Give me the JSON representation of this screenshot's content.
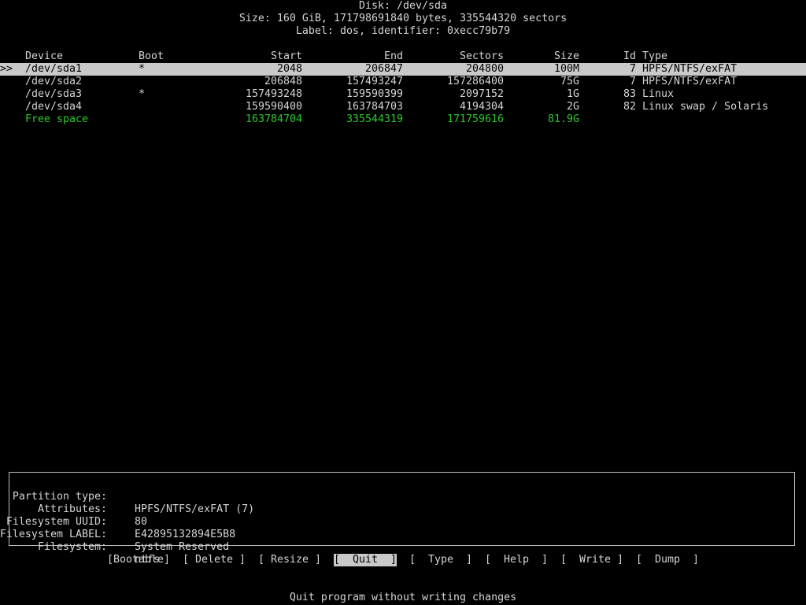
{
  "header": {
    "title": "Disk: /dev/sda",
    "size_line": "Size: 160 GiB, 171798691840 bytes, 335544320 sectors",
    "label_line": "Label: dos, identifier: 0xecc79b79"
  },
  "table": {
    "columns": {
      "device": "Device",
      "boot": "Boot",
      "start": "Start",
      "end": "End",
      "sectors": "Sectors",
      "size": "Size",
      "id": "Id",
      "type": "Type"
    },
    "cursor": ">>",
    "rows": [
      {
        "device": "/dev/sda1",
        "boot": "*",
        "start": "2048",
        "end": "206847",
        "sectors": "204800",
        "size": "100M",
        "id": "7",
        "type": "HPFS/NTFS/exFAT"
      },
      {
        "device": "/dev/sda2",
        "boot": "",
        "start": "206848",
        "end": "157493247",
        "sectors": "157286400",
        "size": "75G",
        "id": "7",
        "type": "HPFS/NTFS/exFAT"
      },
      {
        "device": "/dev/sda3",
        "boot": "*",
        "start": "157493248",
        "end": "159590399",
        "sectors": "2097152",
        "size": "1G",
        "id": "83",
        "type": "Linux"
      },
      {
        "device": "/dev/sda4",
        "boot": "",
        "start": "159590400",
        "end": "163784703",
        "sectors": "4194304",
        "size": "2G",
        "id": "82",
        "type": "Linux swap / Solaris"
      },
      {
        "device": "Free space",
        "boot": "",
        "start": "163784704",
        "end": "335544319",
        "sectors": "171759616",
        "size": "81.9G",
        "id": "",
        "type": ""
      }
    ]
  },
  "info": {
    "partition_type_label": "Partition type:",
    "partition_type_value": "HPFS/NTFS/exFAT (7)",
    "attributes_label": "Attributes:",
    "attributes_value": "80",
    "uuid_label": "Filesystem UUID:",
    "uuid_value": "E42895132894E5B8",
    "fslabel_label": "Filesystem LABEL:",
    "fslabel_value": "System Reserved",
    "filesystem_label": "Filesystem:",
    "filesystem_value": "ntfs"
  },
  "menu": {
    "bootable": "[Bootable]",
    "delete": "[ Delete ]",
    "resize": "[ Resize ]",
    "quit": "[  Quit  ]",
    "type": "[  Type  ]",
    "help": "[  Help  ]",
    "write": "[  Write ]",
    "dump": "[  Dump  ]"
  },
  "hint": "Quit program without writing changes",
  "colors": {
    "background": "#000000",
    "text": "#d4d4d4",
    "selection": "#c9c9c9",
    "free_space": "#2cc82c"
  }
}
